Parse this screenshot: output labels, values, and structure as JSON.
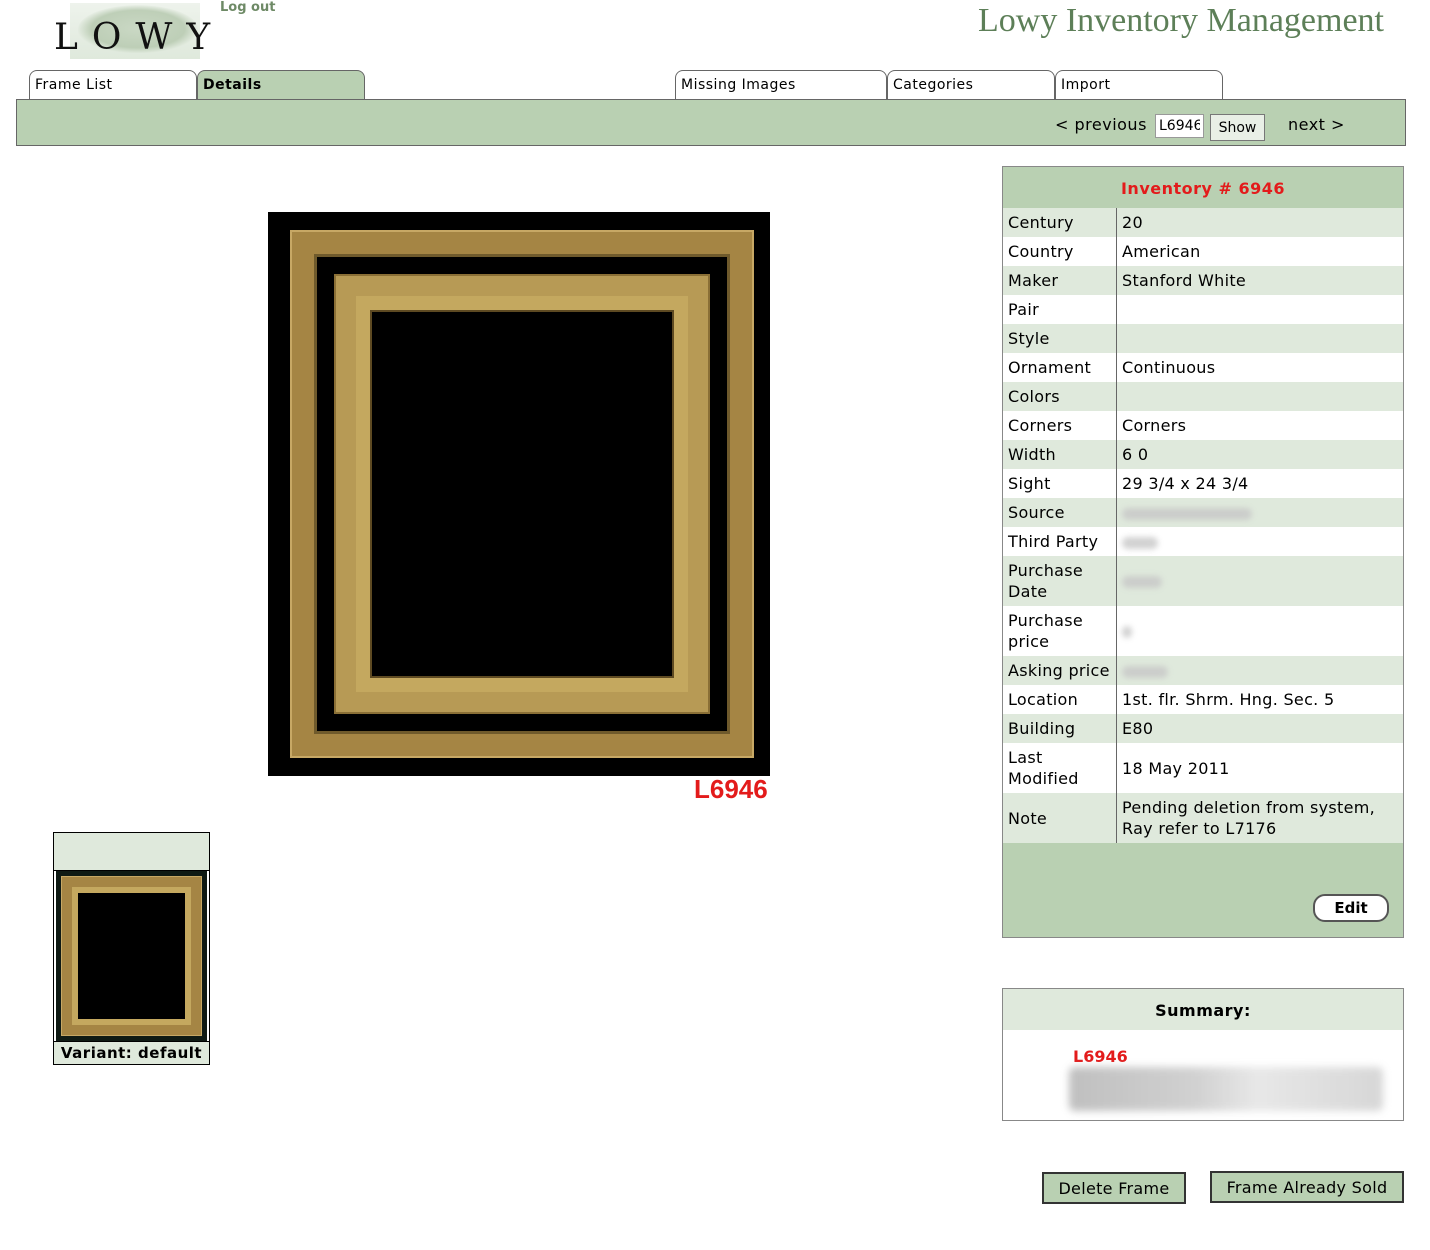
{
  "header": {
    "logo_text": "LOWY",
    "logout_label": "Log out",
    "app_title": "Lowy Inventory Management"
  },
  "tabs": [
    {
      "label": "Frame List",
      "active": false
    },
    {
      "label": "Details",
      "active": true
    },
    {
      "label": "Missing Images",
      "active": false
    },
    {
      "label": "Categories",
      "active": false
    },
    {
      "label": "Import",
      "active": false
    }
  ],
  "nav": {
    "previous_label": "< previous",
    "code_value": "L6946",
    "show_label": "Show",
    "next_label": "next >"
  },
  "main_image": {
    "code_label": "L6946"
  },
  "thumbnail": {
    "variant_label": "Variant: default"
  },
  "details": {
    "title": "Inventory # 6946",
    "rows": [
      {
        "key": "Century",
        "value": "20"
      },
      {
        "key": "Country",
        "value": "American"
      },
      {
        "key": "Maker",
        "value": "Stanford White"
      },
      {
        "key": "Pair",
        "value": ""
      },
      {
        "key": "Style",
        "value": ""
      },
      {
        "key": "Ornament",
        "value": "Continuous"
      },
      {
        "key": "Colors",
        "value": ""
      },
      {
        "key": "Corners",
        "value": "Corners"
      },
      {
        "key": "Width",
        "value": "6 0"
      },
      {
        "key": "Sight",
        "value": "29 3/4 x 24 3/4"
      },
      {
        "key": "Source",
        "value": ""
      },
      {
        "key": "Third Party",
        "value": ""
      },
      {
        "key": "Purchase Date",
        "value": ""
      },
      {
        "key": "Purchase price",
        "value": ""
      },
      {
        "key": "Asking price",
        "value": ""
      },
      {
        "key": "Location",
        "value": "1st. flr. Shrm. Hng. Sec. 5"
      },
      {
        "key": "Building",
        "value": "E80"
      },
      {
        "key": "Last Modified",
        "value": "18 May 2011"
      },
      {
        "key": "Note",
        "value": "Pending deletion from system, Ray refer to L7176"
      }
    ],
    "edit_label": "Edit"
  },
  "summary": {
    "title": "Summary:",
    "code": "L6946"
  },
  "actions": {
    "delete_label": "Delete Frame",
    "sold_label": "Frame Already Sold"
  },
  "colors": {
    "accent_green": "#b9d0b2",
    "light_green": "#dfe9dc",
    "title_green": "#5d7f58",
    "highlight_red": "#e31b1b"
  }
}
